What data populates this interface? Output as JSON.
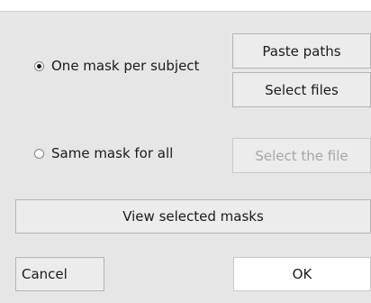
{
  "mask_options": {
    "one_per_subject": {
      "label": "One mask per subject",
      "checked": true
    },
    "same_for_all": {
      "label": "Same mask for all",
      "checked": false
    }
  },
  "buttons": {
    "paste_paths": "Paste paths",
    "select_files": "Select files",
    "select_the_file": "Select the file",
    "view_selected_masks": "View selected masks",
    "cancel": "Cancel",
    "ok": "OK"
  }
}
